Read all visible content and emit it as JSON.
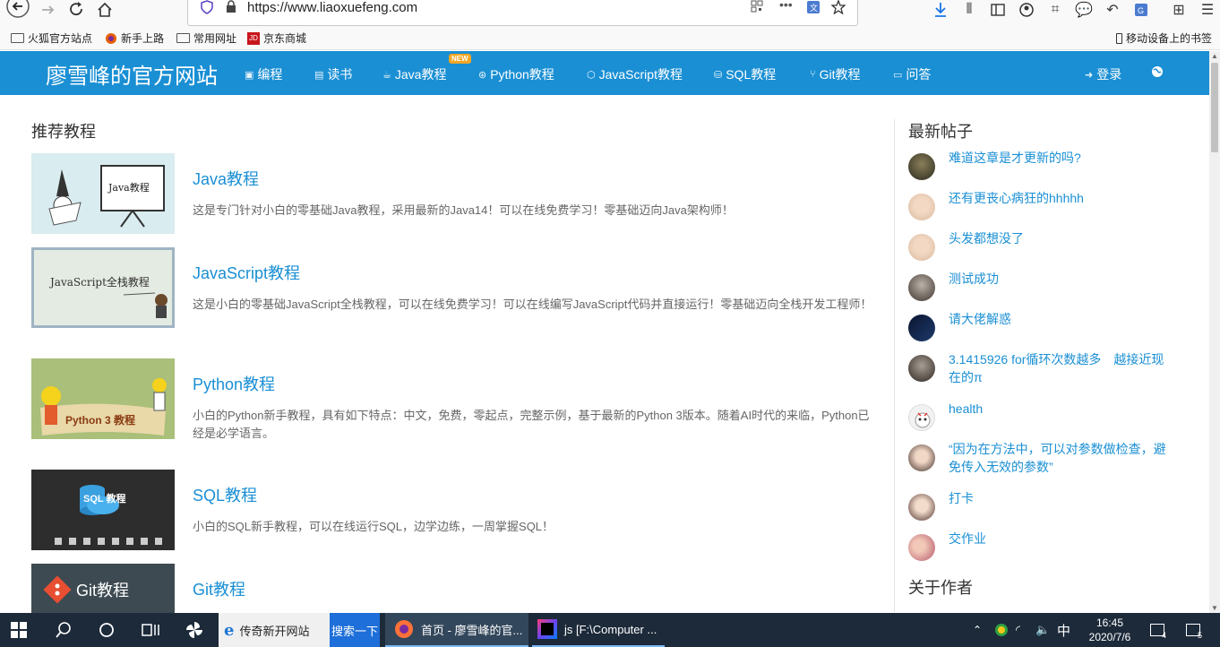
{
  "browser": {
    "url": "https://www.liaoxuefeng.com",
    "bookmarks": [
      "火狐官方站点",
      "新手上路",
      "常用网址",
      "京东商城"
    ],
    "mobile_bookmarks": "移动设备上的书签"
  },
  "site": {
    "title": "廖雪峰的官方网站",
    "nav": [
      {
        "label": "编程",
        "icon": "code-icon"
      },
      {
        "label": "读书",
        "icon": "book-icon"
      },
      {
        "label": "Java教程",
        "icon": "coffee-icon",
        "badge": "NEW"
      },
      {
        "label": "Python教程",
        "icon": "python-icon"
      },
      {
        "label": "JavaScript教程",
        "icon": "js-icon"
      },
      {
        "label": "SQL教程",
        "icon": "database-icon"
      },
      {
        "label": "Git教程",
        "icon": "git-icon"
      },
      {
        "label": "问答",
        "icon": "comment-icon"
      }
    ],
    "login": "登录",
    "brand_color": "#1a8fd4"
  },
  "main": {
    "section_title": "推荐教程",
    "courses": [
      {
        "title": "Java教程",
        "desc": "这是专门针对小白的零基础Java教程，采用最新的Java14！可以在线免费学习！零基础迈向Java架构师！",
        "thumb_text": "Java教程"
      },
      {
        "title": "JavaScript教程",
        "desc": "这是小白的零基础JavaScript全栈教程，可以在线免费学习！可以在线编写JavaScript代码并直接运行！零基础迈向全栈开发工程师！",
        "thumb_text": "JavaScript全栈教程"
      },
      {
        "title": "Python教程",
        "desc": "小白的Python新手教程，具有如下特点：中文，免费，零起点，完整示例，基于最新的Python 3版本。随着AI时代的来临，Python已经是必学语言。",
        "thumb_text": "Python 3 教程"
      },
      {
        "title": "SQL教程",
        "desc": "小白的SQL新手教程，可以在线运行SQL，边学边练，一周掌握SQL！",
        "thumb_text": "SQL 教程"
      },
      {
        "title": "Git教程",
        "desc": "",
        "thumb_text": "Git教程"
      }
    ]
  },
  "sidebar": {
    "latest_title": "最新帖子",
    "posts": [
      "难道这章是才更新的吗?",
      "还有更丧心病狂的hhhhh",
      "头发都想没了",
      "测试成功",
      "请大佬解惑",
      "3.1415926 for循环次数越多　越接近现在的π",
      "health",
      "“因为在方法中，可以对参数做检查，避免传入无效的参数”",
      "打卡",
      "交作业"
    ],
    "about_title": "关于作者"
  },
  "taskbar": {
    "ie_label": "传奇新开网站",
    "search_btn": "搜索一下",
    "firefox_label": "首页 - 廖雪峰的官...",
    "idea_label": "js [F:\\Computer ...",
    "ime": "中",
    "time": "16:45",
    "date": "2020/7/6",
    "notif_count": "4",
    "action_count": "5"
  }
}
